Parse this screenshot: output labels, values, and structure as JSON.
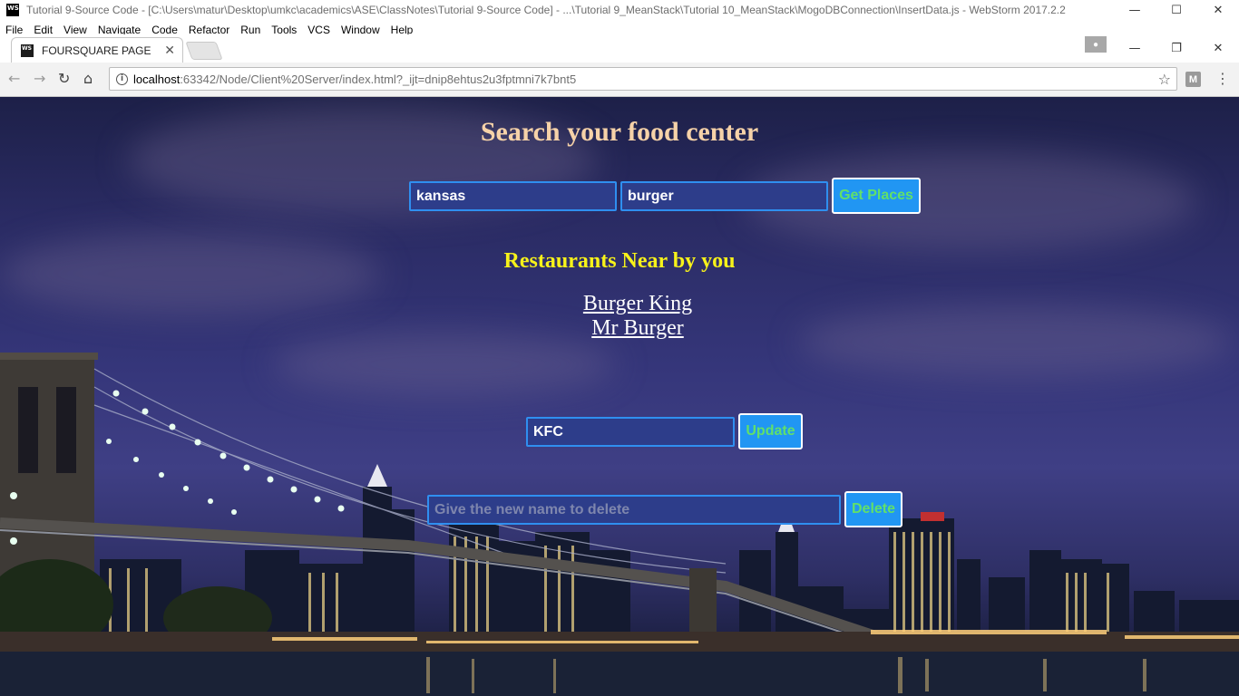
{
  "ide": {
    "logo": "WS",
    "title": "Tutorial 9-Source Code - [C:\\Users\\matur\\Desktop\\umkc\\academics\\ASE\\ClassNotes\\Tutorial 9-Source Code] - ...\\Tutorial 9_MeanStack\\Tutorial 10_MeanStack\\MogoDBConnection\\InsertData.js - WebStorm 2017.2.2",
    "menu": [
      "File",
      "Edit",
      "View",
      "Navigate",
      "Code",
      "Refactor",
      "Run",
      "Tools",
      "VCS",
      "Window",
      "Help"
    ]
  },
  "browser": {
    "tab_title": "FOURSQUARE PAGE",
    "favicon": "WS",
    "url_host": "localhost",
    "url_rest": ":63342/Node/Client%20Server/index.html?_ijt=dnip8ehtus2u3fptmni7k7bnt5",
    "extension_label": "M"
  },
  "page": {
    "title": "Search your food center",
    "city_value": "kansas",
    "food_value": "burger",
    "get_places_label": "Get Places",
    "results_heading": "Restaurants Near by you",
    "results": [
      "Burger King",
      "Mr Burger"
    ],
    "update_value": "KFC",
    "update_label": "Update",
    "delete_placeholder": "Give the new name to delete",
    "delete_label": "Delete"
  },
  "colors": {
    "title": "#f6d2a8",
    "heading": "#f7f21a",
    "button_bg": "#2196f3",
    "button_text": "#61e06a",
    "input_border": "#2f8ff0"
  },
  "icons": [
    "info-icon",
    "star-icon",
    "back-arrow-icon",
    "forward-arrow-icon",
    "reload-icon",
    "home-icon",
    "menu-dots-icon",
    "close-icon",
    "minimize-icon",
    "maximize-icon"
  ]
}
